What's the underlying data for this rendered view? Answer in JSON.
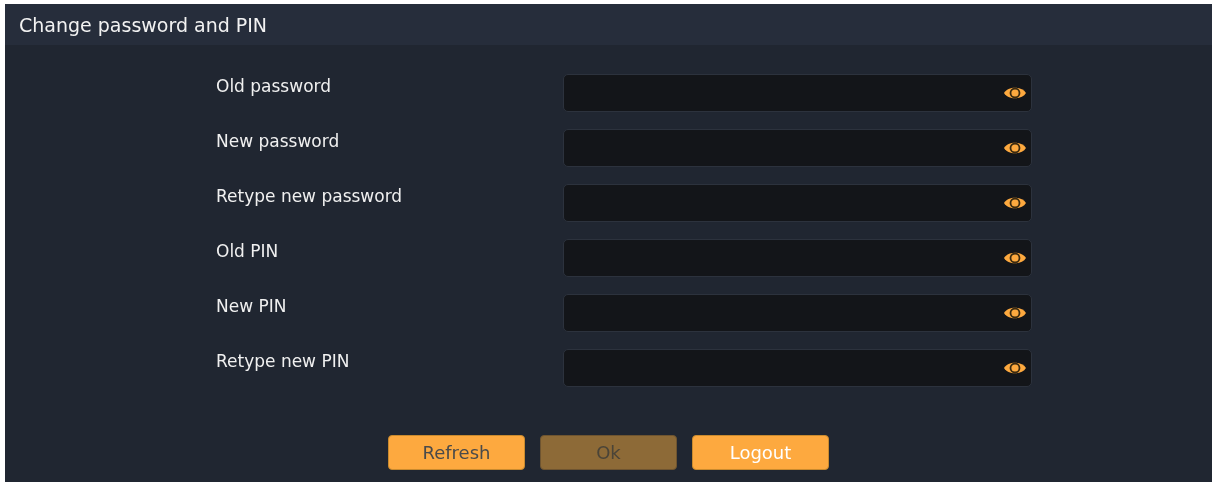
{
  "window": {
    "title": "Change password and PIN"
  },
  "fields": [
    {
      "label": "Old password"
    },
    {
      "label": "New password"
    },
    {
      "label": "Retype new password"
    },
    {
      "label": "Old PIN"
    },
    {
      "label": "New PIN"
    },
    {
      "label": "Retype new PIN"
    }
  ],
  "buttons": [
    {
      "label": "Refresh",
      "kind": "secondary",
      "disabled": false
    },
    {
      "label": "Ok",
      "kind": "secondary",
      "disabled": true
    },
    {
      "label": "Logout",
      "kind": "primary",
      "disabled": false
    }
  ]
}
